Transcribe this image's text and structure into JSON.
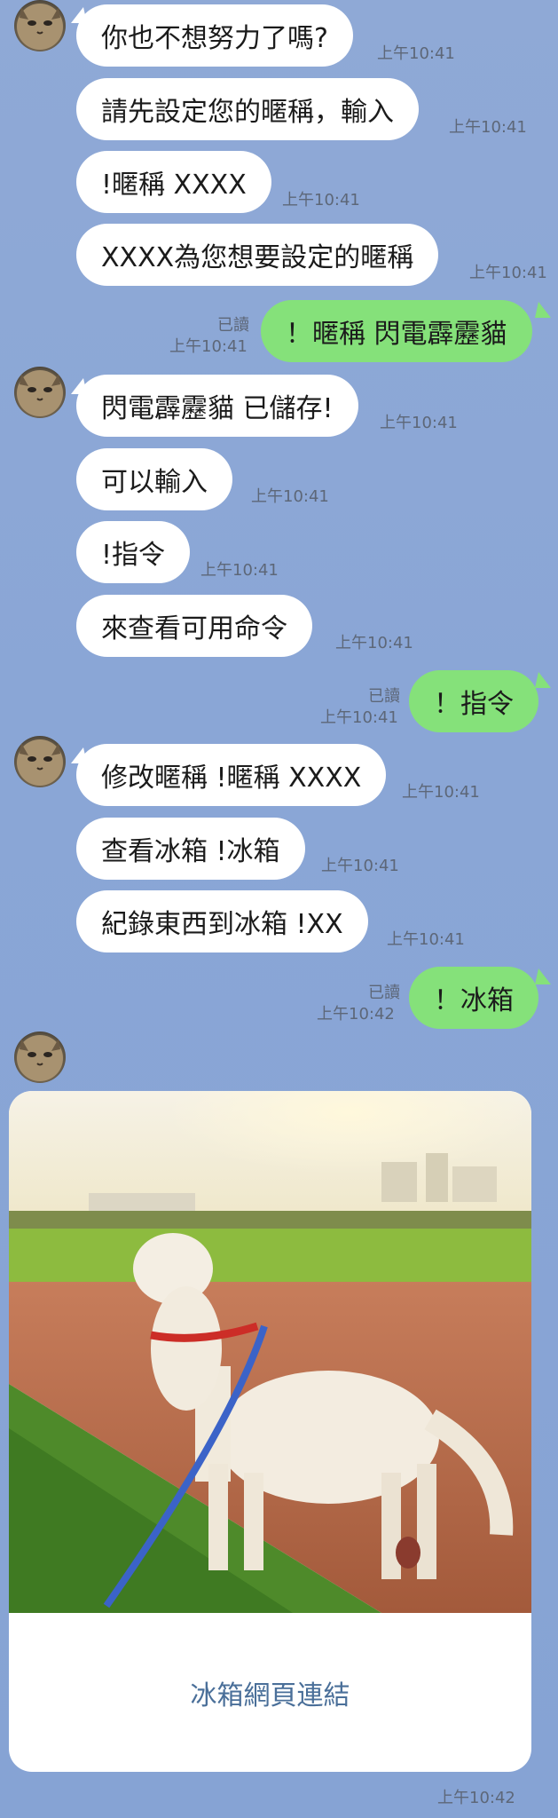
{
  "messages": [
    {
      "text": "你也不想努力了嗎?",
      "time": "上午10:41"
    },
    {
      "text": "請先設定您的暱稱，輸入",
      "time": "上午10:41"
    },
    {
      "text": "!暱稱 XXXX",
      "time": "上午10:41"
    },
    {
      "text": "XXXX為您想要設定的暱稱",
      "time": "上午10:41"
    },
    {
      "text": "！暱稱 閃電霹靂貓",
      "time": "上午10:41",
      "read": "已讀"
    },
    {
      "text": "閃電霹靂貓 已儲存!",
      "time": "上午10:41"
    },
    {
      "text": "可以輸入",
      "time": "上午10:41"
    },
    {
      "text": "!指令",
      "time": "上午10:41"
    },
    {
      "text": "來查看可用命令",
      "time": "上午10:41"
    },
    {
      "text": "！指令",
      "time": "上午10:41",
      "read": "已讀"
    },
    {
      "text": "修改暱稱 !暱稱 XXXX",
      "time": "上午10:41"
    },
    {
      "text": "查看冰箱 !冰箱",
      "time": "上午10:41"
    },
    {
      "text": "紀錄東西到冰箱 !XX",
      "time": "上午10:41"
    },
    {
      "text": "！冰箱",
      "time": "上午10:42",
      "read": "已讀"
    }
  ],
  "card": {
    "image_icon": "dog-photo",
    "link_label": "冰箱網頁連結",
    "time": "上午10:42"
  },
  "colors": {
    "background": "#8aa6d6",
    "incoming_bubble": "#ffffff",
    "outgoing_bubble": "#85e17a",
    "link_text": "#4a6f99",
    "timestamp": "#5d6778"
  }
}
